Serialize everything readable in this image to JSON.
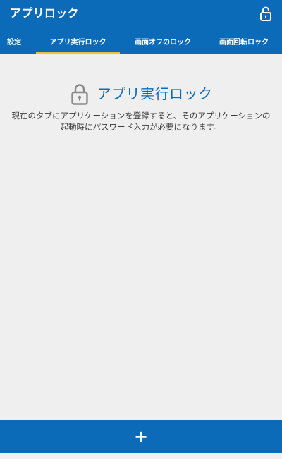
{
  "app_bar": {
    "title": "アプリロック",
    "unlock_icon": "unlock-icon"
  },
  "tabs": [
    {
      "label": "設定",
      "active": false
    },
    {
      "label": "アプリ実行ロック",
      "active": true
    },
    {
      "label": "画面オフのロック",
      "active": false
    },
    {
      "label": "画面回転ロック",
      "active": false
    }
  ],
  "content": {
    "lock_icon": "lock-icon",
    "heading": "アプリ実行ロック",
    "description": "現在のタブにアプリケーションを登録すると、そのアプリケーションの起動時にパスワード入力が必要になります。"
  },
  "add_button": {
    "label": "+"
  },
  "colors": {
    "primary": "#0b6bb8",
    "tab_indicator": "#f1c232",
    "background": "#efefef",
    "icon_gray": "#8a8a8a",
    "text": "#3b3b3b"
  }
}
